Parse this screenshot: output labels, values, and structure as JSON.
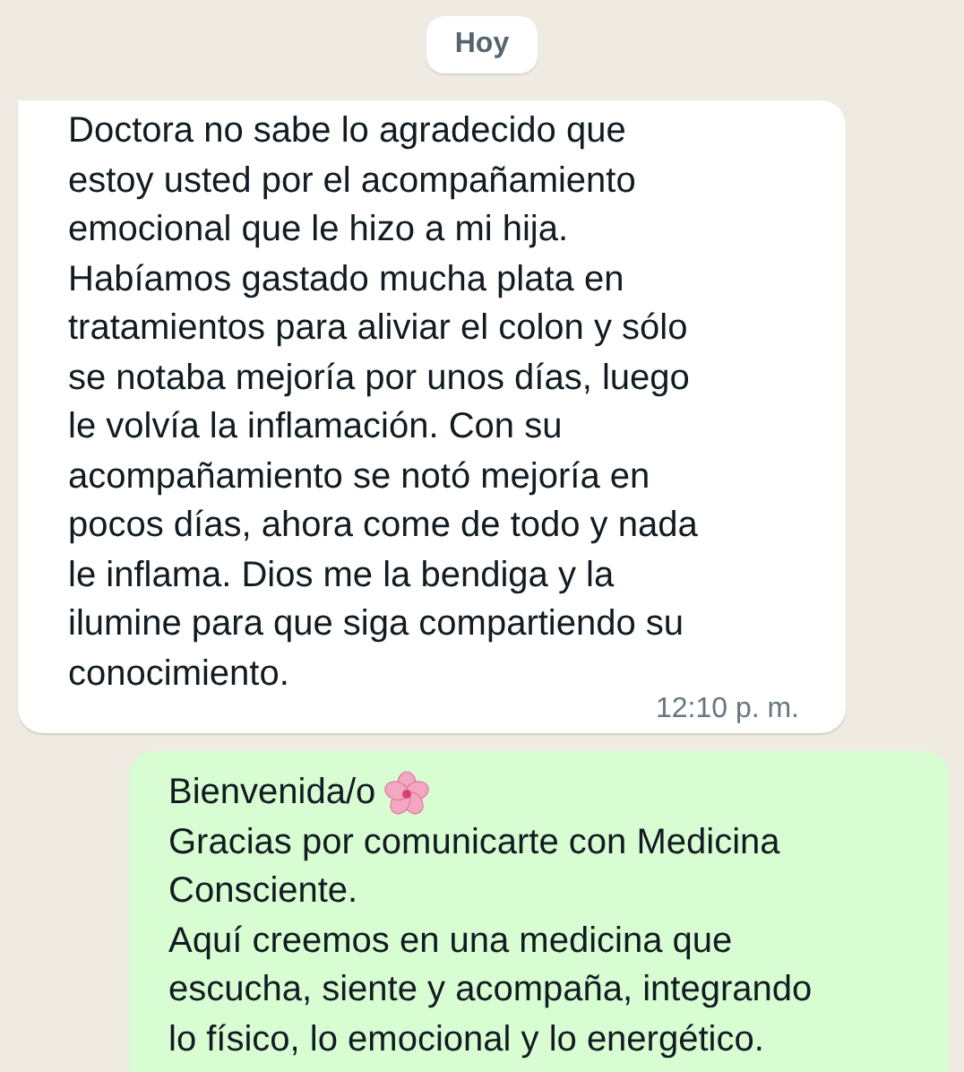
{
  "date_divider": "Hoy",
  "messages": [
    {
      "kind": "incoming",
      "paragraphs": [
        [
          "Doctora no sabe lo agradecido que",
          "estoy usted por el acompañamiento",
          "emocional que le hizo a mi hija.",
          "Habíamos gastado mucha plata en",
          "tratamientos para aliviar el colon y sólo",
          "se notaba mejoría por unos días, luego",
          "le volvía la inflamación. Con su",
          "acompañamiento se notó mejoría en",
          "pocos días, ahora come de todo y nada",
          "le inflama. Dios me la bendiga y la",
          "ilumine para que siga compartiendo su",
          "conocimiento."
        ]
      ],
      "time": "12:10 p. m."
    },
    {
      "kind": "outgoing",
      "greeting": "Bienvenida/o",
      "paragraphs": [
        [
          "Gracias por comunicarte con Medicina",
          "Consciente."
        ],
        [
          "Aquí creemos en una medicina que",
          "escucha, siente y acompaña, integrando",
          "lo físico, lo emocional y lo energético."
        ]
      ]
    }
  ]
}
